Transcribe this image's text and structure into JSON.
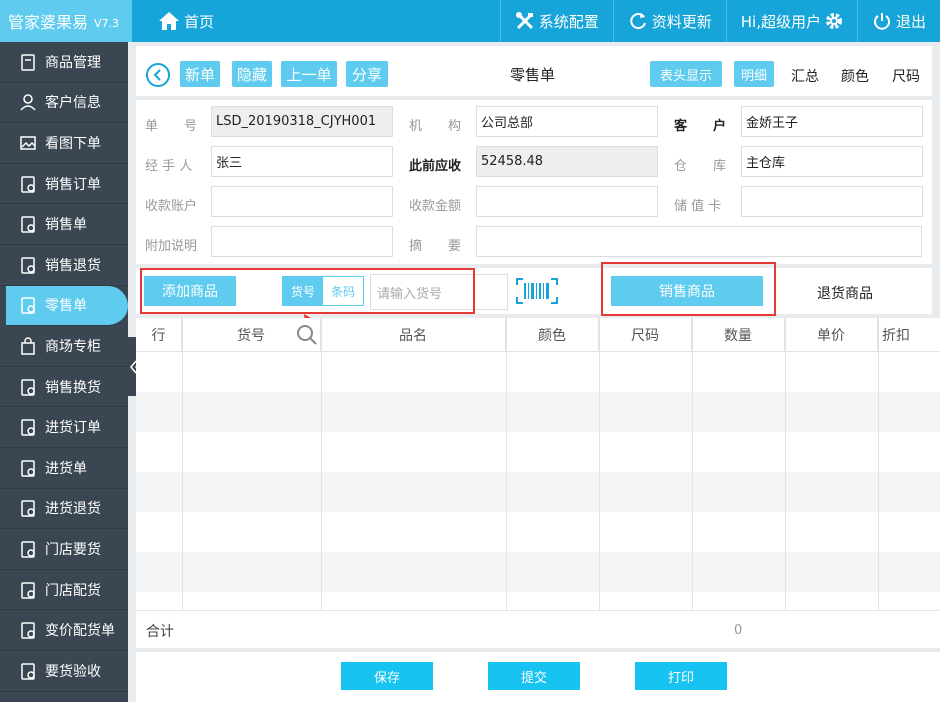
{
  "app": {
    "name": "管家婆果易",
    "version": "V7.3"
  },
  "topbar": {
    "home": "首页",
    "settings": "系统配置",
    "update": "资料更新",
    "user": "Hi,超级用户",
    "logout": "退出"
  },
  "sidebar": {
    "items": [
      {
        "label": "商品管理",
        "icon": "product-icon"
      },
      {
        "label": "客户信息",
        "icon": "user-icon"
      },
      {
        "label": "看图下单",
        "icon": "image-icon"
      },
      {
        "label": "销售订单",
        "icon": "order-icon"
      },
      {
        "label": "销售单",
        "icon": "sale-icon"
      },
      {
        "label": "销售退货",
        "icon": "return-icon"
      },
      {
        "label": "零售单",
        "icon": "retail-icon",
        "active": true
      },
      {
        "label": "商场专柜",
        "icon": "bag-icon"
      },
      {
        "label": "销售换货",
        "icon": "exchange-icon"
      },
      {
        "label": "进货订单",
        "icon": "purchase-order-icon"
      },
      {
        "label": "进货单",
        "icon": "purchase-icon"
      },
      {
        "label": "进货退货",
        "icon": "purchase-return-icon"
      },
      {
        "label": "门店要货",
        "icon": "store-icon"
      },
      {
        "label": "门店配货",
        "icon": "distribute-icon"
      },
      {
        "label": "变价配货单",
        "icon": "price-change-icon"
      },
      {
        "label": "要货验收",
        "icon": "inspect-icon"
      }
    ]
  },
  "toolbar": {
    "new": "新单",
    "hide": "隐藏",
    "prev": "上一单",
    "share": "分享",
    "title": "零售单",
    "header_show": "表头显示",
    "detail": "明细",
    "summary": "汇总",
    "color": "颜色",
    "size": "尺码"
  },
  "form": {
    "bill_no_label": "单　　号",
    "bill_no": "LSD_20190318_CJYH001",
    "org_label": "机　　构",
    "org": "公司总部",
    "customer_label": "客　　户",
    "customer": "金娇王子",
    "handler_label": "经 手 人",
    "handler": "张三",
    "prev_receivable_label": "此前应收",
    "prev_receivable": "52458.48",
    "warehouse_label": "仓　　库",
    "warehouse": "主仓库",
    "account_label": "收款账户",
    "amount_label": "收款金额",
    "card_label": "储 值 卡",
    "note_label": "附加说明",
    "summary_label": "摘　　要"
  },
  "addbar": {
    "add": "添加商品",
    "mode_code": "货号",
    "mode_barcode": "条码",
    "input_placeholder": "请输入货号",
    "sale_tab": "销售商品",
    "return_tab": "退货商品"
  },
  "table": {
    "headers": [
      "行",
      "货号",
      "品名",
      "颜色",
      "尺码",
      "数量",
      "单价",
      "折扣"
    ]
  },
  "total": {
    "label": "合计",
    "qty": "0"
  },
  "footer": {
    "save": "保存",
    "submit": "提交",
    "print": "打印"
  },
  "colors": {
    "primary": "#17a4d8",
    "accent": "#5ecbef",
    "sidebar": "#3a4651",
    "highlight": "#e53935"
  }
}
